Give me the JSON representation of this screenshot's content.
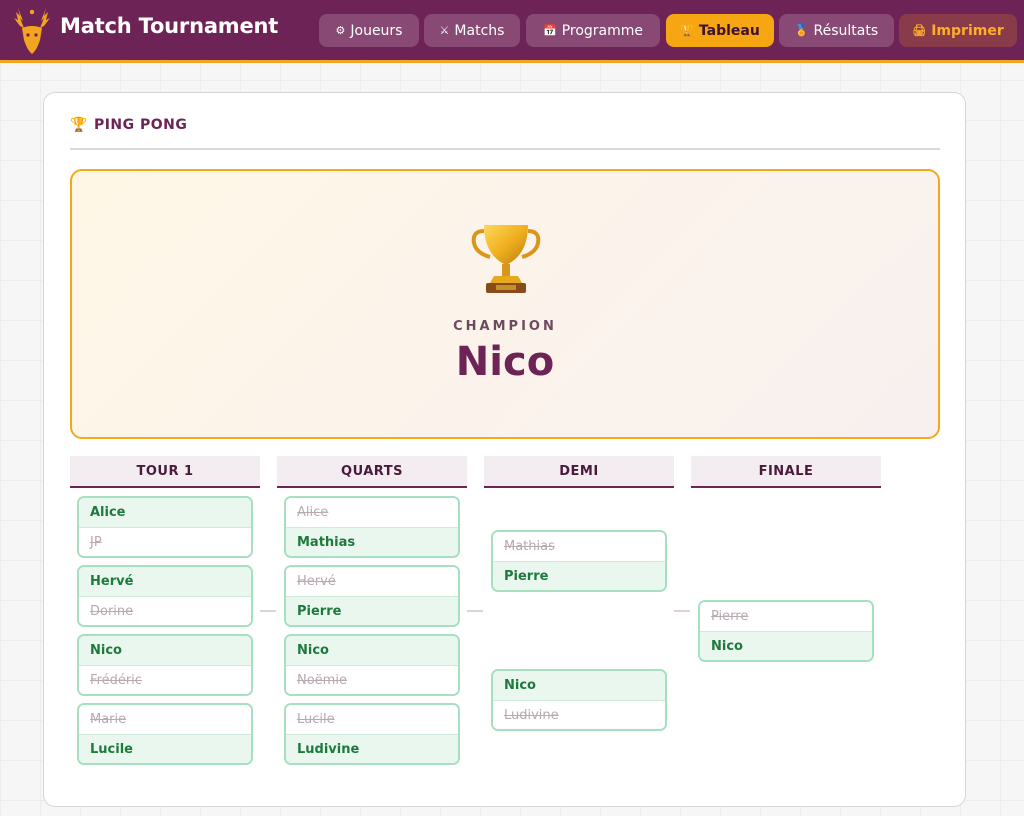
{
  "app": {
    "title": "Match Tournament"
  },
  "nav": [
    {
      "icon": "gear-icon",
      "glyph": "⚙",
      "label": "Joueurs"
    },
    {
      "icon": "swords-icon",
      "glyph": "⚔",
      "label": "Matchs"
    },
    {
      "icon": "calendar-icon",
      "glyph": "📅",
      "label": "Programme"
    },
    {
      "icon": "trophy-icon",
      "glyph": "🏆",
      "label": "Tableau",
      "active": true
    },
    {
      "icon": "medal-icon",
      "glyph": "🏅",
      "label": "Résultats"
    },
    {
      "icon": "printer-icon",
      "glyph": "🖨",
      "label": "Imprimer"
    }
  ],
  "tournament": {
    "name": "PING PONG"
  },
  "champion": {
    "label": "CHAMPION",
    "name": "Nico"
  },
  "rounds": [
    {
      "name": "TOUR 1",
      "matches": [
        {
          "players": [
            {
              "name": "Alice",
              "winner": true
            },
            {
              "name": "JP",
              "winner": false
            }
          ]
        },
        {
          "players": [
            {
              "name": "Hervé",
              "winner": true
            },
            {
              "name": "Dorine",
              "winner": false
            }
          ]
        },
        {
          "players": [
            {
              "name": "Nico",
              "winner": true
            },
            {
              "name": "Frédéric",
              "winner": false
            }
          ]
        },
        {
          "players": [
            {
              "name": "Marie",
              "winner": false
            },
            {
              "name": "Lucile",
              "winner": true
            }
          ]
        }
      ]
    },
    {
      "name": "QUARTS",
      "matches": [
        {
          "players": [
            {
              "name": "Alice",
              "winner": false
            },
            {
              "name": "Mathias",
              "winner": true
            }
          ]
        },
        {
          "players": [
            {
              "name": "Hervé",
              "winner": false
            },
            {
              "name": "Pierre",
              "winner": true
            }
          ]
        },
        {
          "players": [
            {
              "name": "Nico",
              "winner": true
            },
            {
              "name": "Noëmie",
              "winner": false
            }
          ]
        },
        {
          "players": [
            {
              "name": "Lucile",
              "winner": false
            },
            {
              "name": "Ludivine",
              "winner": true
            }
          ]
        }
      ]
    },
    {
      "name": "DEMI",
      "matches": [
        {
          "players": [
            {
              "name": "Mathias",
              "winner": false
            },
            {
              "name": "Pierre",
              "winner": true
            }
          ]
        },
        {
          "players": [
            {
              "name": "Nico",
              "winner": true
            },
            {
              "name": "Ludivine",
              "winner": false
            }
          ]
        }
      ]
    },
    {
      "name": "FINALE",
      "matches": [
        {
          "players": [
            {
              "name": "Pierre",
              "winner": false
            },
            {
              "name": "Nico",
              "winner": true
            }
          ]
        }
      ]
    }
  ],
  "colors": {
    "brand": "#6e2356",
    "accent": "#f5a612",
    "winner": "#1e7a3c",
    "loser": "#b8a9b2"
  }
}
